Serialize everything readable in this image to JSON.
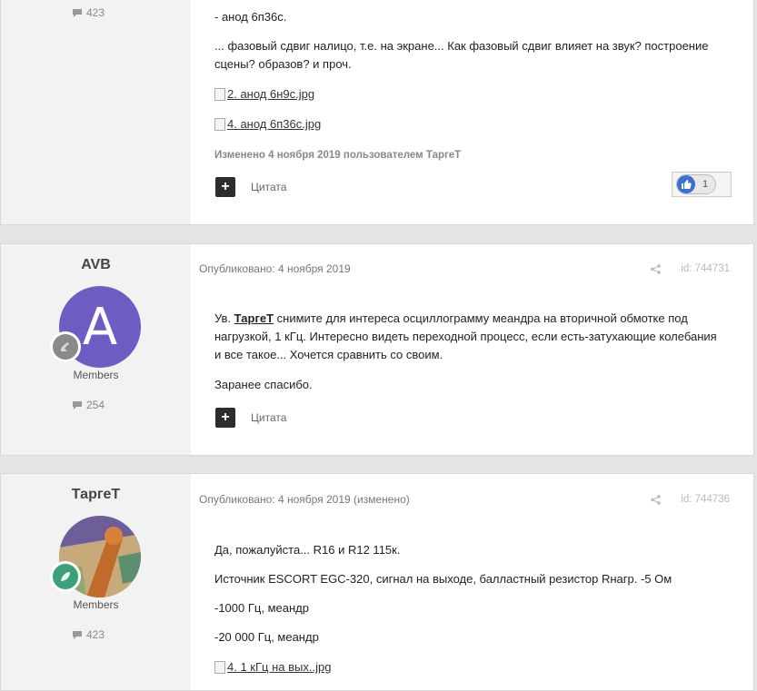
{
  "post1": {
    "count": "423",
    "lines": [
      "- анод 6п36с.",
      "... фазовый сдвиг налицо, т.е. на экране... Как фазовый сдвиг влияет на звук? построение",
      "сцены? образов? и проч."
    ],
    "images": [
      "2. анод 6н9с.jpg",
      "4. анод 6п36с.jpg"
    ],
    "edited": "Изменено 4 ноября 2019 пользователем ТаргеТ",
    "quote_label": "Цитата",
    "reaction_count": "1"
  },
  "post2": {
    "author": "AVB",
    "avatar_letter": "A",
    "group": "Members",
    "count": "254",
    "published": "Опубликовано: 4 ноября 2019",
    "id": "id: 744731",
    "greeting": "Ув. ",
    "mention": "ТаргеТ",
    "line1_rest": " снимите для интереса осциллограмму меандра на вторичной обмотке под",
    "line2": "нагрузкой, 1 кГц. Интересно видеть переходной процесс, если есть-затухающие колебания",
    "line3": "и все такое... Хочется сравнить со своим.",
    "line4": " Заранее спасибо.",
    "quote_label": "Цитата"
  },
  "post3": {
    "author": "ТаргеТ",
    "group": "Members",
    "count": "423",
    "published": "Опубликовано: 4 ноября 2019 (изменено)",
    "id": "id: 744736",
    "lines": [
      "Да, пожалуйста...  R16 и R12  115к.",
      "  Источник ESCORT EGC-320, сигнал на выходе, балластный резистор Rнагр. -5 Ом",
      "-1000 Гц, меандр",
      "-20 000 Гц, меандр"
    ],
    "image": "4. 1 кГц на вых..jpg"
  }
}
